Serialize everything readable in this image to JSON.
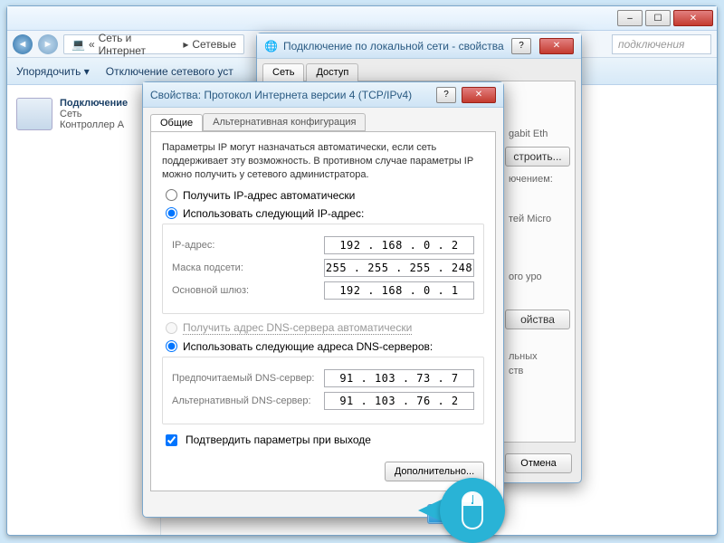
{
  "explorer": {
    "breadcrumb1": "Сеть и Интернет",
    "breadcrumb2": "Сетевые",
    "search_hint": "подключения",
    "toolbar": {
      "organize": "Упорядочить ▾",
      "disable": "Отключение сетевого уст"
    },
    "conn": {
      "title": "Подключение",
      "l2": "Сеть",
      "l3": "Контроллер A"
    }
  },
  "prop": {
    "title": "Подключение по локальной сети - свойства",
    "tab1": "Сеть",
    "tab2": "Доступ",
    "peek1": "gabit Eth",
    "btn_cfg": "строить...",
    "peek2": "ючением:",
    "peek3": "тей Micro",
    "peek4": "ого уро",
    "peek5": "ойства",
    "peek6": "льных",
    "peek7": "ств",
    "cancel": "Отмена"
  },
  "ipv4": {
    "title": "Свойства: Протокол Интернета версии 4 (TCP/IPv4)",
    "tab_general": "Общие",
    "tab_alt": "Альтернативная конфигурация",
    "info": "Параметры IP могут назначаться автоматически, если сеть поддерживает эту возможность. В противном случае параметры IP можно получить у сетевого администратора.",
    "r_auto_ip": "Получить IP-адрес автоматически",
    "r_use_ip": "Использовать следующий IP-адрес:",
    "lab_ip": "IP-адрес:",
    "lab_mask": "Маска подсети:",
    "lab_gw": "Основной шлюз:",
    "val_ip": "192 . 168 .  0  .  2",
    "val_mask": "255 . 255 . 255 . 248",
    "val_gw": "192 . 168 .  0  .  1",
    "r_auto_dns": "Получить адрес DNS-сервера автоматически",
    "r_use_dns": "Использовать следующие адреса DNS-серверов:",
    "lab_dns1": "Предпочитаемый DNS-сервер:",
    "lab_dns2": "Альтернативный DNS-сервер:",
    "val_dns1": "91 . 103 .  73 .  7",
    "val_dns2": "91 . 103 .  76 .  2",
    "chk_validate": "Подтвердить параметры при выходе",
    "btn_adv": "Дополнительно...",
    "btn_ok": "OK"
  }
}
